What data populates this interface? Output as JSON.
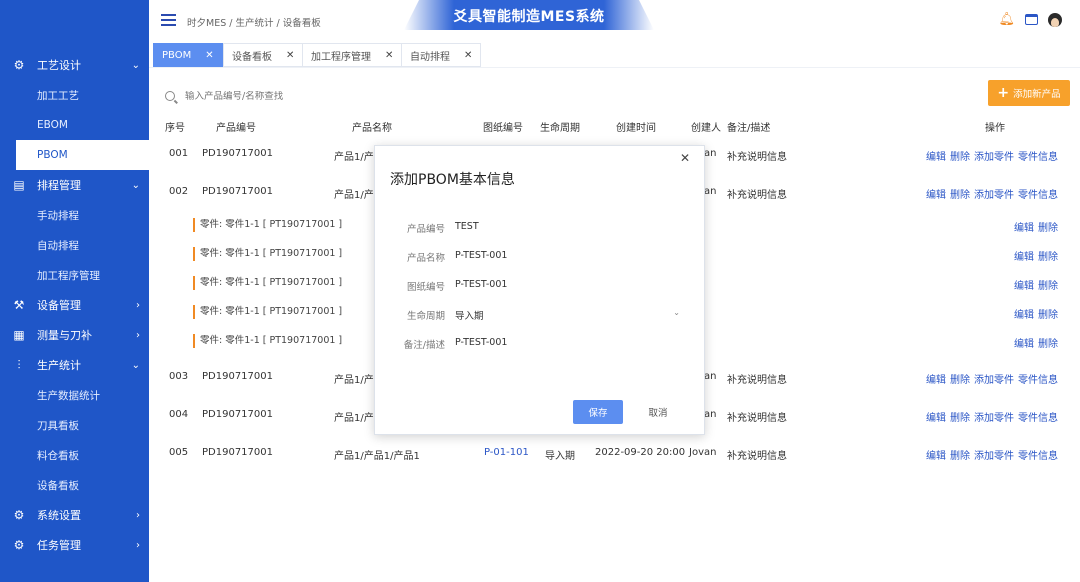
{
  "app": {
    "title": "爻具智能制造MES系统"
  },
  "breadcrumb": "时夕MES / 生产统计 / 设备看板",
  "sidebar": {
    "menu": [
      {
        "label": "工艺设计",
        "icon": "process-design-icon",
        "expanded": true,
        "children": [
          "加工工艺",
          "EBOM",
          "PBOM"
        ]
      },
      {
        "label": "排程管理",
        "icon": "schedule-icon",
        "expanded": true,
        "children": [
          "手动排程",
          "自动排程",
          "加工程序管理"
        ]
      },
      {
        "label": "设备管理",
        "icon": "equipment-icon",
        "expanded": false,
        "children": []
      },
      {
        "label": "测量与刀补",
        "icon": "measure-icon",
        "expanded": false,
        "children": []
      },
      {
        "label": "生产统计",
        "icon": "stats-icon",
        "expanded": true,
        "children": [
          "生产数据统计",
          "刀具看板",
          "料仓看板",
          "设备看板"
        ]
      },
      {
        "label": "系统设置",
        "icon": "settings-icon",
        "expanded": false,
        "children": []
      },
      {
        "label": "任务管理",
        "icon": "task-icon",
        "expanded": false,
        "children": []
      }
    ],
    "active_item": "PBOM"
  },
  "tabs": [
    {
      "label": "PBOM",
      "active": true
    },
    {
      "label": "设备看板",
      "active": false
    },
    {
      "label": "加工程序管理",
      "active": false
    },
    {
      "label": "自动排程",
      "active": false
    }
  ],
  "search": {
    "placeholder": "输入产品编号/名称查找"
  },
  "add_button": {
    "label": "添加新产品"
  },
  "table": {
    "headers": [
      "序号",
      "产品编号",
      "产品名称",
      "图纸编号",
      "生命周期",
      "创建时间",
      "创建人",
      "备注/描述",
      "操作"
    ],
    "rows": [
      {
        "no": "001",
        "code": "PD190717001",
        "name": "产品1/产",
        "creator": "Jovan",
        "remark": "补充说明信息",
        "ops": [
          "编辑",
          "删除",
          "添加零件",
          "零件信息"
        ]
      },
      {
        "no": "002",
        "code": "PD190717001",
        "name": "产品1/产",
        "creator": "Jovan",
        "remark": "补充说明信息",
        "ops": [
          "编辑",
          "删除",
          "添加零件",
          "零件信息"
        ]
      },
      {
        "no": "003",
        "code": "PD190717001",
        "name": "产品1/产",
        "creator": "Jovan",
        "remark": "补充说明信息",
        "ops": [
          "编辑",
          "删除",
          "添加零件",
          "零件信息"
        ]
      },
      {
        "no": "004",
        "code": "PD190717001",
        "name": "产品1/产",
        "creator": "Jovan",
        "remark": "补充说明信息",
        "ops": [
          "编辑",
          "删除",
          "添加零件",
          "零件信息"
        ]
      },
      {
        "no": "005",
        "code": "PD190717001",
        "name": "产品1/产品1/产品1",
        "drawing": "P-01-101",
        "lifecycle": "导入期",
        "created": "2022-09-20 20:00",
        "creator": "Jovan",
        "remark": "补充说明信息",
        "ops": [
          "编辑",
          "删除",
          "添加零件",
          "零件信息"
        ]
      }
    ],
    "parts": [
      {
        "label": "零件: 零件1-1 [ PT190717001 ]",
        "ops": [
          "编辑",
          "删除"
        ]
      },
      {
        "label": "零件: 零件1-1 [ PT190717001 ]",
        "ops": [
          "编辑",
          "删除"
        ]
      },
      {
        "label": "零件: 零件1-1 [ PT190717001 ]",
        "ops": [
          "编辑",
          "删除"
        ]
      },
      {
        "label": "零件: 零件1-1 [ PT190717001 ]",
        "ops": [
          "编辑",
          "删除"
        ]
      },
      {
        "label": "零件: 零件1-1 [ PT190717001 ]",
        "ops": [
          "编辑",
          "删除"
        ]
      }
    ]
  },
  "modal": {
    "title": "添加PBOM基本信息",
    "fields": [
      {
        "label": "产品编号",
        "value": "TEST"
      },
      {
        "label": "产品名称",
        "value": "P-TEST-001"
      },
      {
        "label": "图纸编号",
        "value": "P-TEST-001"
      },
      {
        "label": "生命周期",
        "value": "导入期"
      },
      {
        "label": "备注/描述",
        "value": "P-TEST-001"
      }
    ],
    "save_label": "保存",
    "cancel_label": "取消"
  }
}
